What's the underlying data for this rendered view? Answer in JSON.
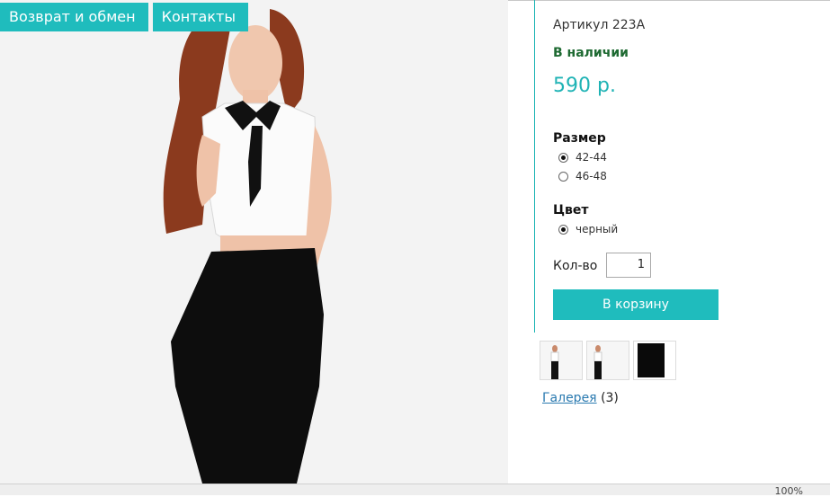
{
  "nav": {
    "returns_label": "Возврат и обмен",
    "contacts_label": "Контакты"
  },
  "product": {
    "sku": "Артикул 223А",
    "availability": "В наличии",
    "price": "590 р."
  },
  "size": {
    "label": "Размер",
    "options": [
      {
        "label": "42-44",
        "selected": true
      },
      {
        "label": "46-48",
        "selected": false
      }
    ]
  },
  "color": {
    "label": "Цвет",
    "options": [
      {
        "label": "черный",
        "selected": true
      }
    ]
  },
  "quantity": {
    "label": "Кол-во",
    "value": "1"
  },
  "cart_button": "В корзину",
  "gallery": {
    "link": "Галерея",
    "count": "(3)"
  },
  "status_bar": {
    "zoom": "100%"
  },
  "colors": {
    "accent": "#1fbcbd",
    "in_stock": "#1e6a32",
    "price": "#1fb3b5",
    "link": "#2a7ab0"
  }
}
